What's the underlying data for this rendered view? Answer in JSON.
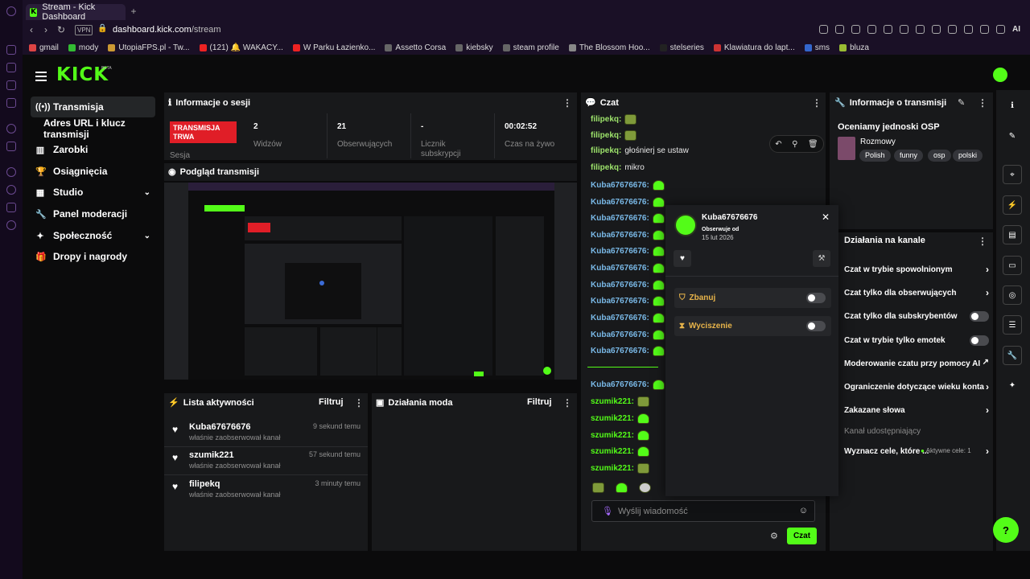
{
  "browser": {
    "tab_title": "Stream - Kick Dashboard",
    "url_host": "dashboard.kick.com",
    "url_path": "/stream",
    "vpn_label": "VPN",
    "bookmarks": [
      "gmail",
      "mody",
      "UtopiaFPS.pl - Tw...",
      "(121) 🔔 WAKACY...",
      "W Parku Łazienko...",
      "Assetto Corsa",
      "kiebsky",
      "steam profile",
      "The Blossom Hoo...",
      "stelseries",
      "Klawiatura do lapt...",
      "sms",
      "bluza"
    ],
    "ai_label": "AI"
  },
  "brand": {
    "logo": "KICK",
    "beta": "BETA"
  },
  "sidebar": {
    "items": [
      {
        "label": "Transmisja",
        "icon": "broadcast-icon"
      },
      {
        "label": "Adres URL i klucz transmisji",
        "icon": ""
      },
      {
        "label": "Zarobki",
        "icon": "chart-icon"
      },
      {
        "label": "Osiągnięcia",
        "icon": "trophy-icon"
      },
      {
        "label": "Studio",
        "icon": "studio-icon"
      },
      {
        "label": "Panel moderacji",
        "icon": "wrench-icon"
      },
      {
        "label": "Społeczność",
        "icon": "community-icon"
      },
      {
        "label": "Dropy i nagrody",
        "icon": "gift-icon"
      }
    ]
  },
  "session": {
    "title": "Informacje o sesji",
    "badge": "TRANSMISJA TRWA",
    "badge_sub": "Sesja",
    "stats": [
      {
        "value": "2",
        "label": "Widzów"
      },
      {
        "value": "21",
        "label": "Obserwujących"
      },
      {
        "value": "-",
        "label": "Licznik subskrypcji"
      },
      {
        "value": "00:02:52",
        "label": "Czas na żywo"
      }
    ]
  },
  "preview": {
    "title": "Podgląd transmisji"
  },
  "activity": {
    "title": "Lista aktywności",
    "filter": "Filtruj",
    "items": [
      {
        "name": "Kuba67676676",
        "sub": "właśnie zaobserwował kanał",
        "time": "9 sekund temu"
      },
      {
        "name": "szumik221",
        "sub": "właśnie zaobserwował kanał",
        "time": "57 sekund temu"
      },
      {
        "name": "filipekq",
        "sub": "właśnie zaobserwował kanał",
        "time": "3 minuty temu"
      }
    ]
  },
  "mod_actions": {
    "title": "Działania moda",
    "filter": "Filtruj"
  },
  "chat": {
    "title": "Czat",
    "messages": [
      {
        "user": "filipekq:",
        "text": "",
        "color": "#9de36b",
        "emote": "y"
      },
      {
        "user": "filipekq:",
        "text": "",
        "color": "#9de36b",
        "emote": "y"
      },
      {
        "user": "filipekq:",
        "text": "głośnierj se ustaw",
        "color": "#9de36b",
        "emote": ""
      },
      {
        "user": "filipekq:",
        "text": "mikro",
        "color": "#9de36b",
        "emote": ""
      },
      {
        "user": "Kuba67676676:",
        "text": "",
        "color": "#79b8e6",
        "emote": "g"
      },
      {
        "user": "Kuba67676676:",
        "text": "",
        "color": "#79b8e6",
        "emote": "g"
      },
      {
        "user": "Kuba67676676:",
        "text": "",
        "color": "#79b8e6",
        "emote": "g"
      },
      {
        "user": "Kuba67676676:",
        "text": "",
        "color": "#79b8e6",
        "emote": "g"
      },
      {
        "user": "Kuba67676676:",
        "text": "",
        "color": "#79b8e6",
        "emote": "g"
      },
      {
        "user": "Kuba67676676:",
        "text": "",
        "color": "#79b8e6",
        "emote": "g"
      },
      {
        "user": "Kuba67676676:",
        "text": "",
        "color": "#79b8e6",
        "emote": "g"
      },
      {
        "user": "Kuba67676676:",
        "text": "",
        "color": "#79b8e6",
        "emote": "g"
      },
      {
        "user": "Kuba67676676:",
        "text": "",
        "color": "#79b8e6",
        "emote": "g"
      },
      {
        "user": "Kuba67676676:",
        "text": "",
        "color": "#79b8e6",
        "emote": "g"
      },
      {
        "user": "Kuba67676676:",
        "text": "",
        "color": "#79b8e6",
        "emote": "g"
      },
      {
        "user": "Kuba67676676:",
        "text": "",
        "color": "#79b8e6",
        "emote": "g"
      },
      {
        "user": "szumik221:",
        "text": "",
        "color": "#53fc18",
        "emote": "y"
      },
      {
        "user": "szumik221:",
        "text": "",
        "color": "#53fc18",
        "emote": "g"
      },
      {
        "user": "szumik221:",
        "text": "",
        "color": "#53fc18",
        "emote": "g"
      },
      {
        "user": "szumik221:",
        "text": "",
        "color": "#53fc18",
        "emote": "g"
      },
      {
        "user": "szumik221:",
        "text": "",
        "color": "#53fc18",
        "emote": "y"
      }
    ],
    "input_placeholder": "Wyślij wiadomość",
    "send_label": "Czat"
  },
  "user_card": {
    "username": "Kuba67676676",
    "follow_label": "Obserwuje od",
    "follow_date": "15 lut 2026",
    "ban_label": "Zbanuj",
    "timeout_label": "Wyciszenie"
  },
  "stream_info": {
    "title": "Informacje o transmisji",
    "stream_title": "Oceniamy jednoski OSP",
    "category": "Rozmowy",
    "tags": [
      "Polish",
      "funny",
      "osp",
      "polski"
    ]
  },
  "channel_actions": {
    "title": "Działania na kanale",
    "rows": [
      {
        "label": "Czat w trybie spowolnionym",
        "control": "chevron"
      },
      {
        "label": "Czat tylko dla obserwujących",
        "control": "chevron"
      },
      {
        "label": "Czat tylko dla subskrybentów",
        "control": "switch"
      },
      {
        "label": "Czat w trybie tylko emotek",
        "control": "switch"
      },
      {
        "label": "Moderowanie czatu przy pomocy AI",
        "control": "external"
      },
      {
        "label": "Ograniczenie dotyczące wieku konta",
        "control": "chevron"
      },
      {
        "label": "Zakazane słowa",
        "control": "chevron"
      },
      {
        "label": "Kanał udostępniający",
        "control": "none"
      },
      {
        "label": "Wyznacz cele, które ...",
        "control": "chevron",
        "extra": "Aktywne cele: 1"
      }
    ]
  },
  "colors": {
    "accent": "#53fc18",
    "live": "#e01e27",
    "panel": "#18191b",
    "bg": "#0b0b0c"
  }
}
